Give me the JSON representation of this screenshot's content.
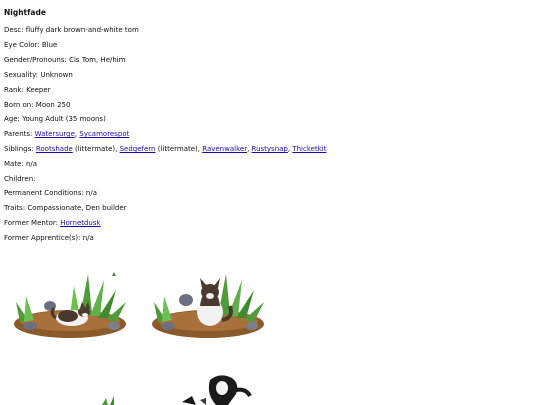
{
  "name": "Nightfade",
  "fields": {
    "desc": "Desc: fluffy dark brown-and-white tom",
    "eye": "Eye Color: Blue",
    "gender": "Gender/Pronouns: Cis Tom, He/him",
    "sexuality": "Sexuality: Unknown",
    "rank": "Rank: Keeper",
    "born": "Born on: Moon 250",
    "age": "Age: Young Adult (35 moons)",
    "mate": "Mate: n/a",
    "children": "Children:",
    "conditions": "Permanent Conditions: n/a",
    "traits": "Traits: Compassionate, Den builder",
    "apprentice": "Former Apprentice(s): n/a"
  },
  "parents": {
    "label": "Parents: ",
    "links": [
      "Watersurge",
      "Sycamorespot"
    ],
    "sep": ", "
  },
  "siblings": {
    "label": "Siblings: ",
    "links": [
      "Rootshade",
      "Sedgefern",
      "Ravenwalker",
      "Rustysnap",
      "Thicketkit"
    ],
    "suffix0": " (littermate), ",
    "suffix1": " (littermate), ",
    "sep": ", "
  },
  "mentor": {
    "label": "Former Mentor: ",
    "link": "Hornetdusk"
  },
  "colors": {
    "link": "#1a0dab",
    "grass": "#4f9a3a",
    "dirt": "#8b5a2b",
    "fur_dark": "#4a3a2e",
    "fur_white": "#f2f2f2"
  }
}
